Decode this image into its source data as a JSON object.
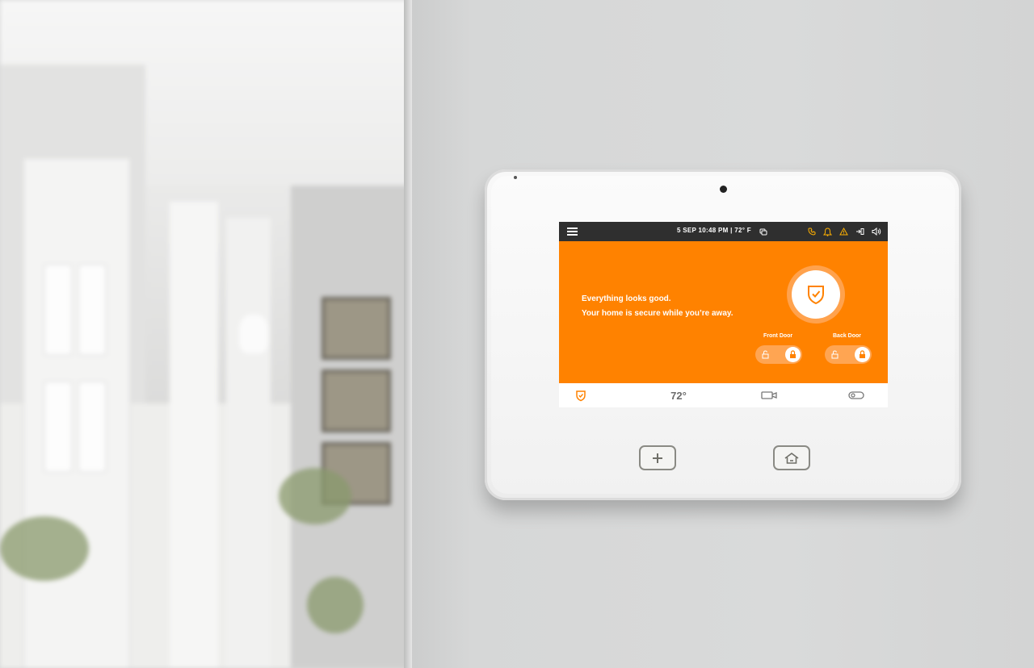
{
  "colors": {
    "accent": "#ff8200",
    "statusbar": "#2f2f2f",
    "alert": "#ffb000"
  },
  "statusbar": {
    "datetime": "5  SEP  10:48 PM | 72° F",
    "icons": [
      "menu-icon",
      "cloud-sync-icon",
      "phone-icon",
      "bell-icon",
      "warning-icon",
      "exit-icon",
      "volume-icon"
    ]
  },
  "hero": {
    "line1": "Everything looks good.",
    "line2": "Your home is secure while you’re away.",
    "status_icon": "shield-check-icon"
  },
  "locks": [
    {
      "label": "Front Door",
      "locked": true
    },
    {
      "label": "Back Door",
      "locked": true
    }
  ],
  "tabs": [
    {
      "icon": "shield-icon",
      "active": true
    },
    {
      "label": "72°"
    },
    {
      "icon": "camera-icon"
    },
    {
      "icon": "toggle-icon"
    }
  ],
  "hardware_buttons": [
    "plus-icon",
    "home-icon"
  ]
}
